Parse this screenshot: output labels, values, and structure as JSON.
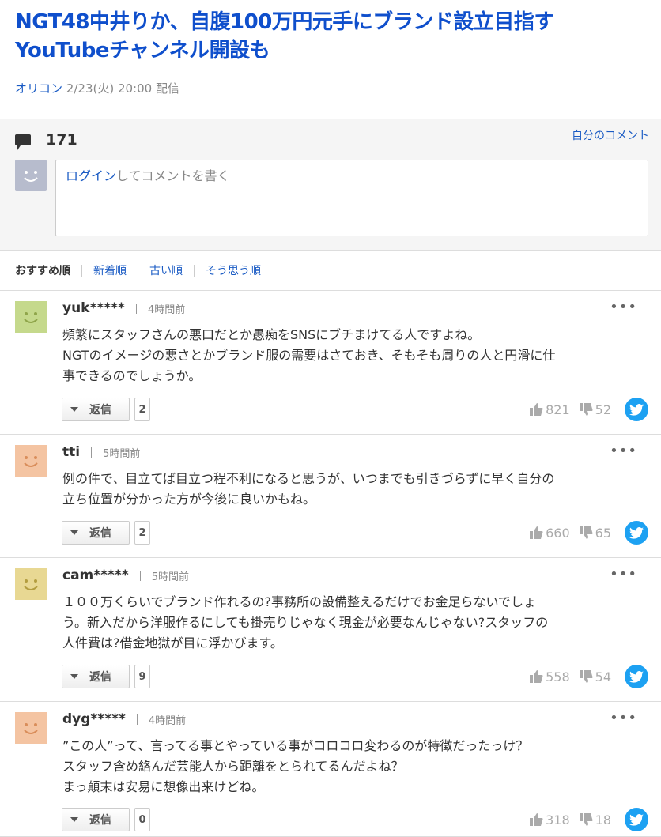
{
  "article": {
    "title_line1": "NGT48中井りか、自腹100万円元手にブランド設立目指す",
    "title_line2": "YouTubeチャンネル開設も",
    "source": "オリコン",
    "datetime": "2/23(火) 20:00",
    "delivered": "配信"
  },
  "comment_box": {
    "count": "171",
    "my_comments": "自分のコメント",
    "login_link": "ログイン",
    "login_rest": "してコメントを書く"
  },
  "sort": {
    "items": [
      "おすすめ順",
      "新着順",
      "古い順",
      "そう思う順"
    ]
  },
  "colors": {
    "title": "#0f4fcc",
    "link": "#1a5bc4",
    "twitter": "#1da1f2"
  },
  "comments": [
    {
      "user": "yuk*****",
      "time": "4時間前",
      "lines": [
        "頻繁にスタッフさんの悪口だとか愚痴をSNSにブチまけてる人ですよね。",
        "NGTのイメージの悪さとかブランド服の需要はさておき、そもそも周りの人と円滑に仕",
        "事できるのでしょうか。"
      ],
      "reply_label": "返信",
      "reply_count": "2",
      "likes": "821",
      "dislikes": "52",
      "avatar_color": "#c5d98c",
      "avatar_fg": "#8fa54a"
    },
    {
      "user": "tti",
      "time": "5時間前",
      "lines": [
        "例の件で、目立てば目立つ程不利になると思うが、いつまでも引きづらずに早く自分の",
        "立ち位置が分かった方が今後に良いかもね。"
      ],
      "reply_label": "返信",
      "reply_count": "2",
      "likes": "660",
      "dislikes": "65",
      "avatar_color": "#f4c4a2",
      "avatar_fg": "#d98d5a"
    },
    {
      "user": "cam*****",
      "time": "5時間前",
      "lines": [
        "１００万くらいでブランド作れるの?事務所の設備整えるだけでお金足らないでしょ",
        "う。新入だから洋服作るにしても掛売りじゃなく現金が必要なんじゃない?スタッフの",
        "人件費は?借金地獄が目に浮かびます。"
      ],
      "reply_label": "返信",
      "reply_count": "9",
      "likes": "558",
      "dislikes": "54",
      "avatar_color": "#e8d893",
      "avatar_fg": "#b39d3f"
    },
    {
      "user": "dyg*****",
      "time": "4時間前",
      "lines": [
        "”この人”って、言ってる事とやっている事がコロコロ変わるのが特徴だったっけ？",
        "スタッフ含め絡んだ芸能人から距離をとられてるんだよね？",
        "まっ顛末は安易に想像出来けどね。"
      ],
      "reply_label": "返信",
      "reply_count": "0",
      "likes": "318",
      "dislikes": "18",
      "avatar_color": "#f4c4a2",
      "avatar_fg": "#d98d5a"
    }
  ]
}
